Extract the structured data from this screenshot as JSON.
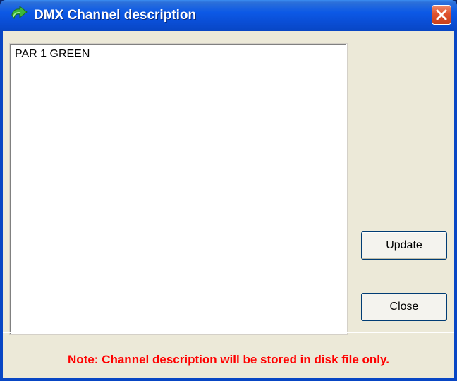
{
  "window": {
    "title": "DMX Channel description",
    "icon": "green-arrow-icon",
    "close_icon": "close-x-icon"
  },
  "description": {
    "value": "PAR 1 GREEN"
  },
  "buttons": {
    "update_label": "Update",
    "close_label": "Close"
  },
  "note": {
    "text": "Note: Channel description will be stored in disk file only.",
    "color": "#ff0000"
  },
  "colors": {
    "titlebar": "#0a4ed6",
    "close_button": "#e0532e",
    "dialog_background": "#ece9d8"
  }
}
